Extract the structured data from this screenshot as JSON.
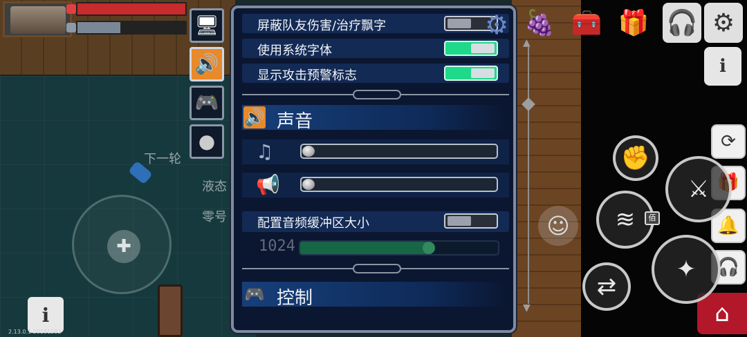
{
  "hud": {
    "world_text": [
      "下一轮",
      "液态",
      "零号"
    ],
    "version": "2.13.0.1 20181582"
  },
  "tabs": [
    {
      "name": "display",
      "icon": "monitor-icon"
    },
    {
      "name": "sound",
      "icon": "speaker-icon"
    },
    {
      "name": "control",
      "icon": "gamepad-icon"
    },
    {
      "name": "other",
      "icon": "ball-icon"
    }
  ],
  "settings": {
    "toggles": [
      {
        "label": "屏蔽队友伤害/治疗飘字",
        "state": "off"
      },
      {
        "label": "使用系统字体",
        "state": "on"
      },
      {
        "label": "显示攻击预警标志",
        "state": "on"
      }
    ],
    "sound_section": {
      "title": "声音",
      "music_volume": 0.0,
      "sfx_volume": 0.0,
      "buffer_label": "配置音频缓冲区大小",
      "buffer_state": "off",
      "buffer_value": "1024",
      "buffer_level": 0.65
    },
    "control_section": {
      "title": "控制"
    }
  },
  "side": {
    "badge_text": "佰"
  },
  "colors": {
    "panel_bg": "#0b1630",
    "row_bg": "#132a55",
    "toggle_on": "#1fd98a",
    "home_red": "#b3172a"
  }
}
